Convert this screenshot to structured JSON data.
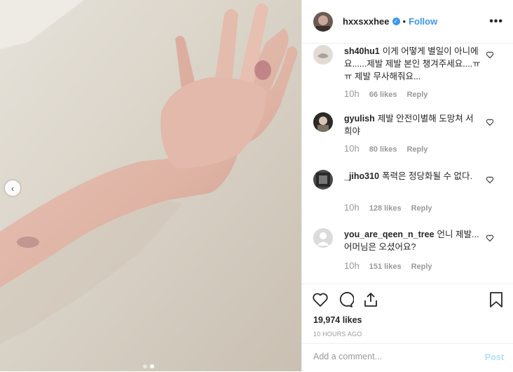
{
  "post": {
    "username": "hxxsxxhee",
    "verified_mark": "✓",
    "separator": "•",
    "follow_label": "Follow",
    "more_label": "•••"
  },
  "comments": [
    {
      "user": "sh40hu1",
      "text": "이게 어떻게 별일이 아니에요......제발 제발 본인 챙겨주세요....ㅠㅠ 제발 무사해줘요...",
      "time": "10h",
      "likes": "66 likes",
      "reply": "Reply"
    },
    {
      "user": "gyulish",
      "text": "제발 안전이별해 도망쳐 서희야",
      "time": "10h",
      "likes": "80 likes",
      "reply": "Reply"
    },
    {
      "user": "_jiho310",
      "text": "폭력은 정당화될 수 없다.",
      "time": "10h",
      "likes": "128 likes",
      "reply": "Reply"
    },
    {
      "user": "you_are_qeen_n_tree",
      "text": "언니 제발... 어머님은 오셨어요?",
      "time": "10h",
      "likes": "151 likes",
      "reply": "Reply"
    }
  ],
  "stats": {
    "likes": "19,974 likes",
    "time": "10 HOURS AGO"
  },
  "add_comment": {
    "placeholder": "Add a comment...",
    "post_label": "Post"
  },
  "icons": {
    "prev": "chevron-left-icon",
    "like": "heart-icon",
    "comment": "comment-icon",
    "share": "share-icon",
    "save": "bookmark-icon"
  },
  "colors": {
    "accent": "#3897f0",
    "muted": "#999999",
    "post_disabled": "#b2dffc"
  }
}
